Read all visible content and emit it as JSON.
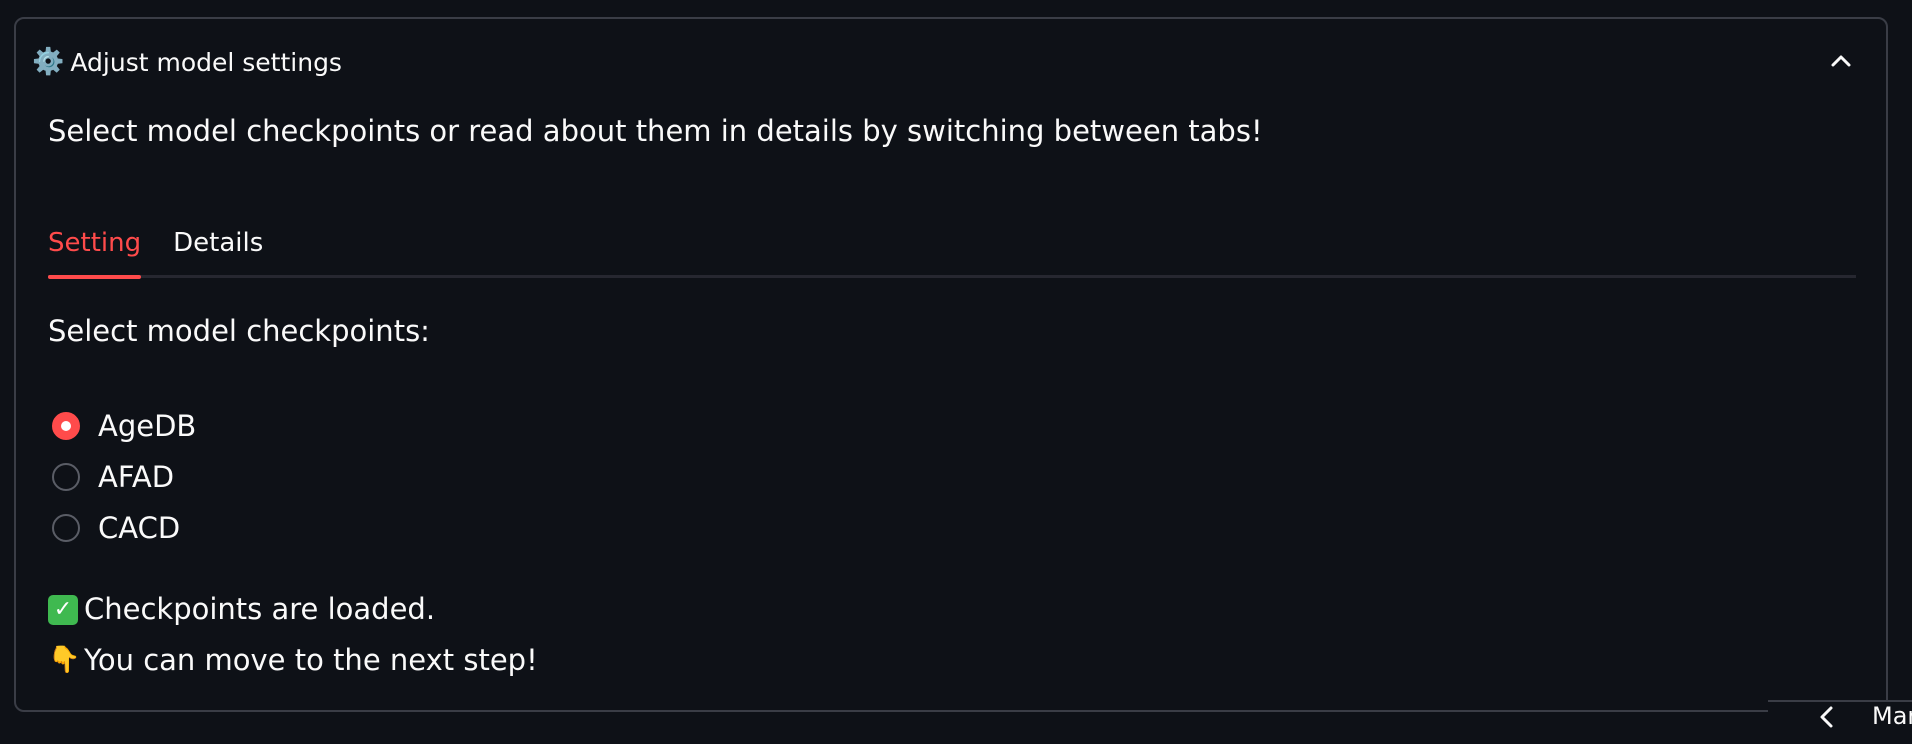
{
  "expander": {
    "icon": "gear-icon",
    "title": "Adjust model settings",
    "collapse_icon": "chevron-up-icon"
  },
  "intro_text": "Select model checkpoints or read about them in details by switching between tabs!",
  "tabs": [
    {
      "label": "Setting",
      "active": true
    },
    {
      "label": "Details",
      "active": false
    }
  ],
  "select_label": "Select model checkpoints:",
  "radio_options": [
    {
      "label": "AgeDB",
      "selected": true
    },
    {
      "label": "AFAD",
      "selected": false
    },
    {
      "label": "CACD",
      "selected": false
    }
  ],
  "status": {
    "loaded_icon": "check-mark-icon",
    "loaded_text": "Checkpoints are loaded.",
    "next_icon": "pointing-down-icon",
    "next_text": "You can move to the next step!"
  },
  "bottom_bar": {
    "back_icon": "chevron-left-icon",
    "manage_text": "Manage app"
  },
  "colors": {
    "background": "#0e1117",
    "accent": "#ff4b4b",
    "text": "#fafafa",
    "border": "#3a3d46"
  }
}
